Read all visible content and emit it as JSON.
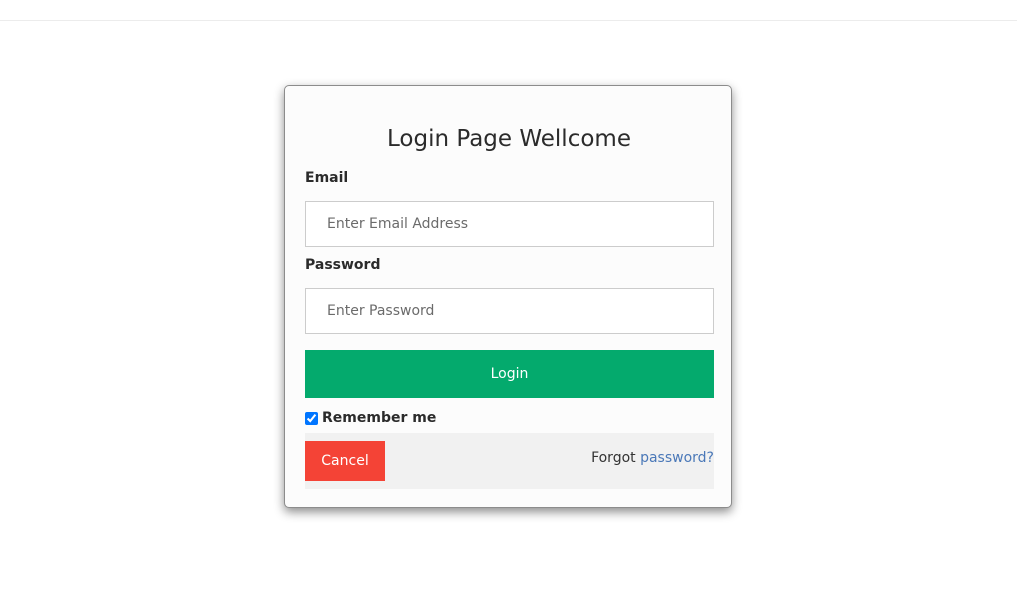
{
  "page": {
    "title": "Login Page Wellcome"
  },
  "form": {
    "email_label": "Email",
    "email_placeholder": "Enter Email Address",
    "email_value": "",
    "password_label": "Password",
    "password_placeholder": "Enter Password",
    "password_value": "",
    "login_label": "Login",
    "remember_label": "Remember me",
    "remember_checked": true
  },
  "footer": {
    "cancel_label": "Cancel",
    "forgot_prefix": "Forgot ",
    "forgot_link": "password?"
  },
  "colors": {
    "login_button": "#04aa6d",
    "cancel_button": "#f44336",
    "link": "#4a78b8"
  }
}
